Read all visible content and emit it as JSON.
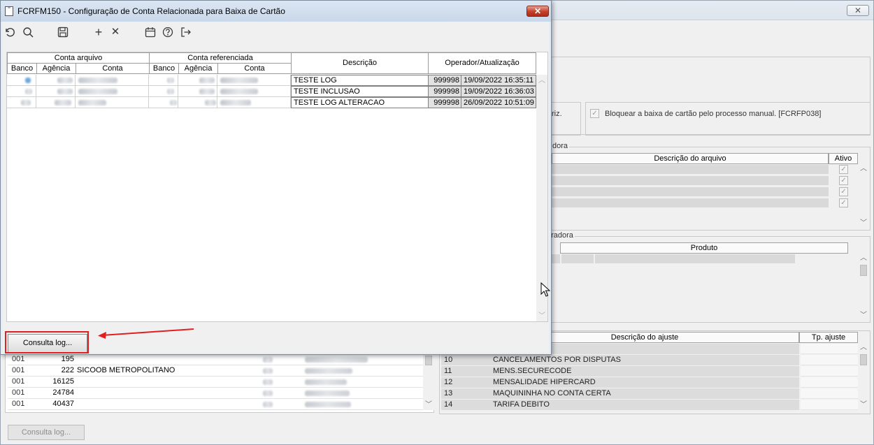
{
  "background_window": {
    "close_glyph": "✕",
    "check_label": "Bloquear a baixa de cartão pelo processo manual. [FCRFP038]",
    "partial_label_riz": "riz.",
    "group_operadora_partial": "dora",
    "group_produto_partial": "eradora",
    "col_descricao_arquivo": "Descrição do arquivo",
    "col_ativo": "Ativo",
    "col_produto": "Produto",
    "col_descricao_ajuste": "Descrição do ajuste",
    "col_tp_ajuste": "Tp. ajuste",
    "left_rows": [
      {
        "banco": "001",
        "agencia": "195",
        "nome": ""
      },
      {
        "banco": "001",
        "agencia": "222",
        "nome": "SICOOB METROPOLITANO"
      },
      {
        "banco": "001",
        "agencia": "16125",
        "nome": ""
      },
      {
        "banco": "001",
        "agencia": "24784",
        "nome": ""
      },
      {
        "banco": "001",
        "agencia": "40437",
        "nome": ""
      }
    ],
    "ajuste_rows": [
      {
        "codigo": "10",
        "descricao": "CANCELAMENTOS POR DISPUTAS"
      },
      {
        "codigo": "11",
        "descricao": "MENS.SECURECODE"
      },
      {
        "codigo": "12",
        "descricao": "MENSALIDADE HIPERCARD"
      },
      {
        "codigo": "13",
        "descricao": "MAQUININHA NO CONTA CERTA"
      },
      {
        "codigo": "14",
        "descricao": "TARIFA DEBITO"
      }
    ],
    "consulta_log_label": "Consulta log..."
  },
  "dialog": {
    "title": "FCRFM150 - Configuração de Conta Relacionada para Baixa de Cartão",
    "close_glyph": "✕",
    "toolbar": {
      "undo_icon": "undo-icon",
      "search_icon": "search-icon",
      "save_icon": "save-icon",
      "add_glyph": "+",
      "delete_glyph": "✕",
      "calendar_icon": "calendar-icon",
      "help_icon": "help-icon",
      "exit_icon": "exit-icon"
    },
    "grid": {
      "group_conta_arquivo": "Conta arquivo",
      "group_conta_referenciada": "Conta referenciada",
      "col_banco": "Banco",
      "col_agencia": "Agência",
      "col_conta": "Conta",
      "col_descricao": "Descrição",
      "col_operador": "Operador/Atualização",
      "rows": [
        {
          "descricao": "TESTE LOG",
          "operador": "999998",
          "atualizacao": "19/09/2022 16:35:11"
        },
        {
          "descricao": "TESTE INCLUSAO",
          "operador": "999998",
          "atualizacao": "19/09/2022 16:36:03"
        },
        {
          "descricao": "TESTE LOG ALTERACAO",
          "operador": "999998",
          "atualizacao": "26/09/2022 10:51:09"
        }
      ]
    },
    "consulta_log_label": "Consulta log..."
  },
  "colors": {
    "highlight_red": "#e02020",
    "close_red": "#c4402a"
  }
}
